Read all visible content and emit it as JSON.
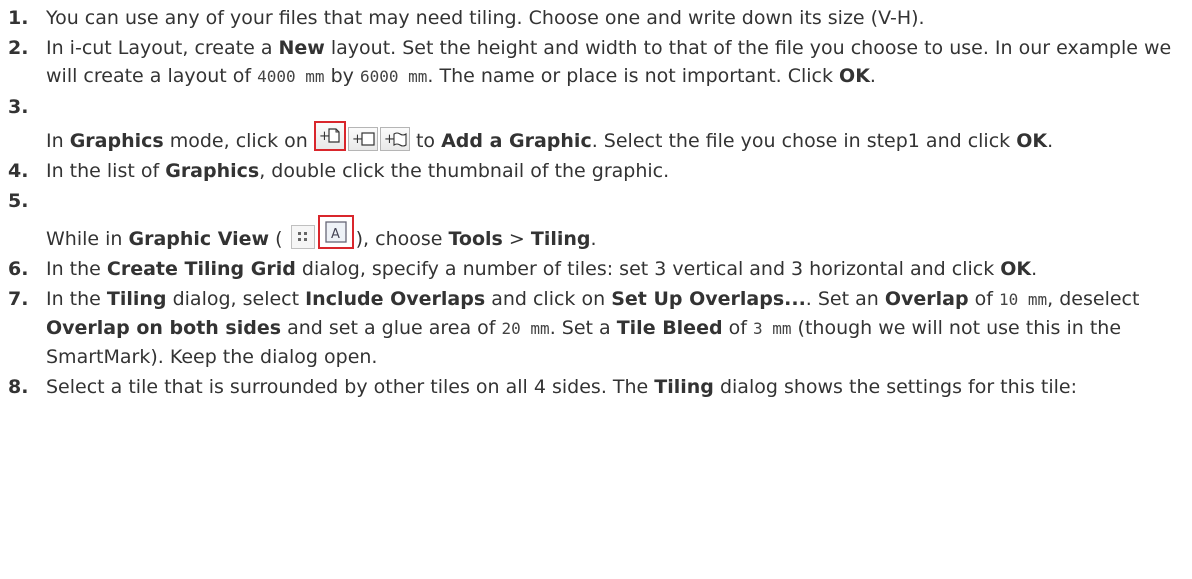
{
  "steps": [
    {
      "n": "1.",
      "parts": [
        "You can use any of your files that may need tiling. Choose one and write down its size (V-H)."
      ]
    },
    {
      "n": "2.",
      "p1": "In i-cut Layout, create a ",
      "new": "New",
      "p2": " layout. Set the height and width to that of the file you choose to use. In our example we will create a layout of ",
      "dim1": "4000 mm",
      "by": " by ",
      "dim2": "6000 mm",
      "p3": ". The name or place is not important. Click ",
      "ok": "OK",
      "end": "."
    },
    {
      "n": "3.",
      "p1": "In ",
      "graphics": "Graphics",
      "p2": " mode, click on ",
      "p3": " to ",
      "add": "Add a Graphic",
      "p4": ". Select the file you chose in step1 and click ",
      "ok": "OK",
      "end": "."
    },
    {
      "n": "4.",
      "p1": "In the list of ",
      "graphics": "Graphics",
      "p2": ", double click the thumbnail of the graphic."
    },
    {
      "n": "5.",
      "p1": "While in ",
      "gview": "Graphic View",
      "p2": " (",
      "p3": "), choose ",
      "tools": "Tools",
      "gt": " > ",
      "tiling": "Tiling",
      "end": "."
    },
    {
      "n": "6.",
      "p1": "In the ",
      "ctg": "Create Tiling Grid",
      "p2": " dialog, specify a number of tiles: set 3 vertical and 3 horizontal and click ",
      "ok": "OK",
      "end": "."
    },
    {
      "n": "7.",
      "p1": "In the ",
      "tiling": "Tiling",
      "p2": " dialog, select ",
      "inc": "Include Overlaps",
      "p3": " and click on ",
      "setup": "Set Up Overlaps...",
      "p4": ". Set an ",
      "overlap": "Overlap",
      "p5": " of ",
      "v1": "10 mm",
      "p6": ", deselect ",
      "both": "Overlap on both sides",
      "p7": " and set a glue area of ",
      "v2": "20 mm",
      "p8": ". Set a ",
      "tb": "Tile Bleed",
      "p9": " of ",
      "v3": "3 mm",
      "p10": " (though we will not use this in the SmartMark). Keep the dialog open."
    },
    {
      "n": "8.",
      "p1": "Select a tile that is surrounded by other tiles on all 4 sides. The ",
      "tiling": "Tiling",
      "p2": " dialog shows the settings for this tile:"
    }
  ],
  "icons": {
    "add_graphic": "add-graphic-icon",
    "add_rectangle": "add-rectangle-icon",
    "add_shape": "add-shape-icon",
    "list_view": "list-view-icon",
    "graphic_view": "graphic-view-icon",
    "highlight_color": "#d9262c"
  }
}
